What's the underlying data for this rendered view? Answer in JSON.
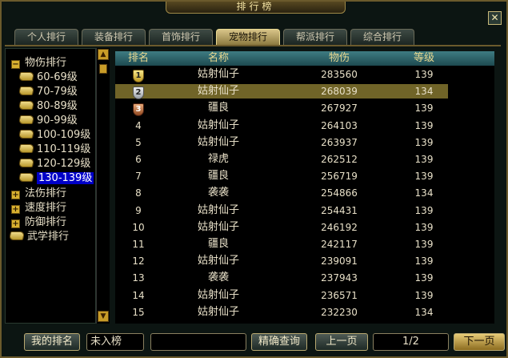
{
  "window": {
    "title": "排行榜",
    "close_glyph": "✕"
  },
  "tabs": [
    {
      "label": "个人排行",
      "active": false
    },
    {
      "label": "装备排行",
      "active": false
    },
    {
      "label": "首饰排行",
      "active": false
    },
    {
      "label": "宠物排行",
      "active": true
    },
    {
      "label": "帮派排行",
      "active": false
    },
    {
      "label": "综合排行",
      "active": false
    }
  ],
  "tree": {
    "root": {
      "label": "物伤排行",
      "expander": "−"
    },
    "children": [
      {
        "label": "60-69级",
        "icon": "book-icon"
      },
      {
        "label": "70-79级",
        "icon": "book-icon"
      },
      {
        "label": "80-89级",
        "icon": "book-icon"
      },
      {
        "label": "90-99级",
        "icon": "book-icon"
      },
      {
        "label": "100-109级",
        "icon": "book-icon"
      },
      {
        "label": "110-119级",
        "icon": "book-icon"
      },
      {
        "label": "120-129级",
        "icon": "book-icon"
      },
      {
        "label": "130-139级",
        "icon": "book-icon",
        "selected": true
      }
    ],
    "others": [
      {
        "label": "法伤排行",
        "expander": "+"
      },
      {
        "label": "速度排行",
        "expander": "+"
      },
      {
        "label": "防御排行",
        "expander": "+"
      },
      {
        "label": "武学排行",
        "icon": "book-icon"
      }
    ],
    "scroll_up": "▲",
    "scroll_down": "▼"
  },
  "table": {
    "headers": [
      "排名",
      "名称",
      "物伤",
      "等级"
    ],
    "rows": [
      {
        "rank": "1",
        "medal": "gold",
        "name": "姑射仙子",
        "damage": "283560",
        "level": "139"
      },
      {
        "rank": "2",
        "medal": "silver",
        "name": "姑射仙子",
        "damage": "268039",
        "level": "134",
        "selected": true
      },
      {
        "rank": "3",
        "medal": "bronze",
        "name": "疆良",
        "damage": "267927",
        "level": "139"
      },
      {
        "rank": "4",
        "name": "姑射仙子",
        "damage": "264103",
        "level": "139"
      },
      {
        "rank": "5",
        "name": "姑射仙子",
        "damage": "263937",
        "level": "139"
      },
      {
        "rank": "6",
        "name": "禄虎",
        "damage": "262512",
        "level": "139"
      },
      {
        "rank": "7",
        "name": "疆良",
        "damage": "256719",
        "level": "139"
      },
      {
        "rank": "8",
        "name": "袭袭",
        "damage": "254866",
        "level": "134"
      },
      {
        "rank": "9",
        "name": "姑射仙子",
        "damage": "254431",
        "level": "139"
      },
      {
        "rank": "10",
        "name": "姑射仙子",
        "damage": "246192",
        "level": "139"
      },
      {
        "rank": "11",
        "name": "疆良",
        "damage": "242117",
        "level": "139"
      },
      {
        "rank": "12",
        "name": "姑射仙子",
        "damage": "239091",
        "level": "139"
      },
      {
        "rank": "13",
        "name": "袭袭",
        "damage": "237943",
        "level": "139"
      },
      {
        "rank": "14",
        "name": "姑射仙子",
        "damage": "236571",
        "level": "139"
      },
      {
        "rank": "15",
        "name": "姑射仙子",
        "damage": "232230",
        "level": "134"
      }
    ]
  },
  "bottom": {
    "my_rank_label": "我的排名",
    "my_rank_value": "未入榜",
    "search_value": "",
    "search_button": "精确查询",
    "prev_button": "上一页",
    "page": "1/2",
    "next_button": "下一页"
  }
}
